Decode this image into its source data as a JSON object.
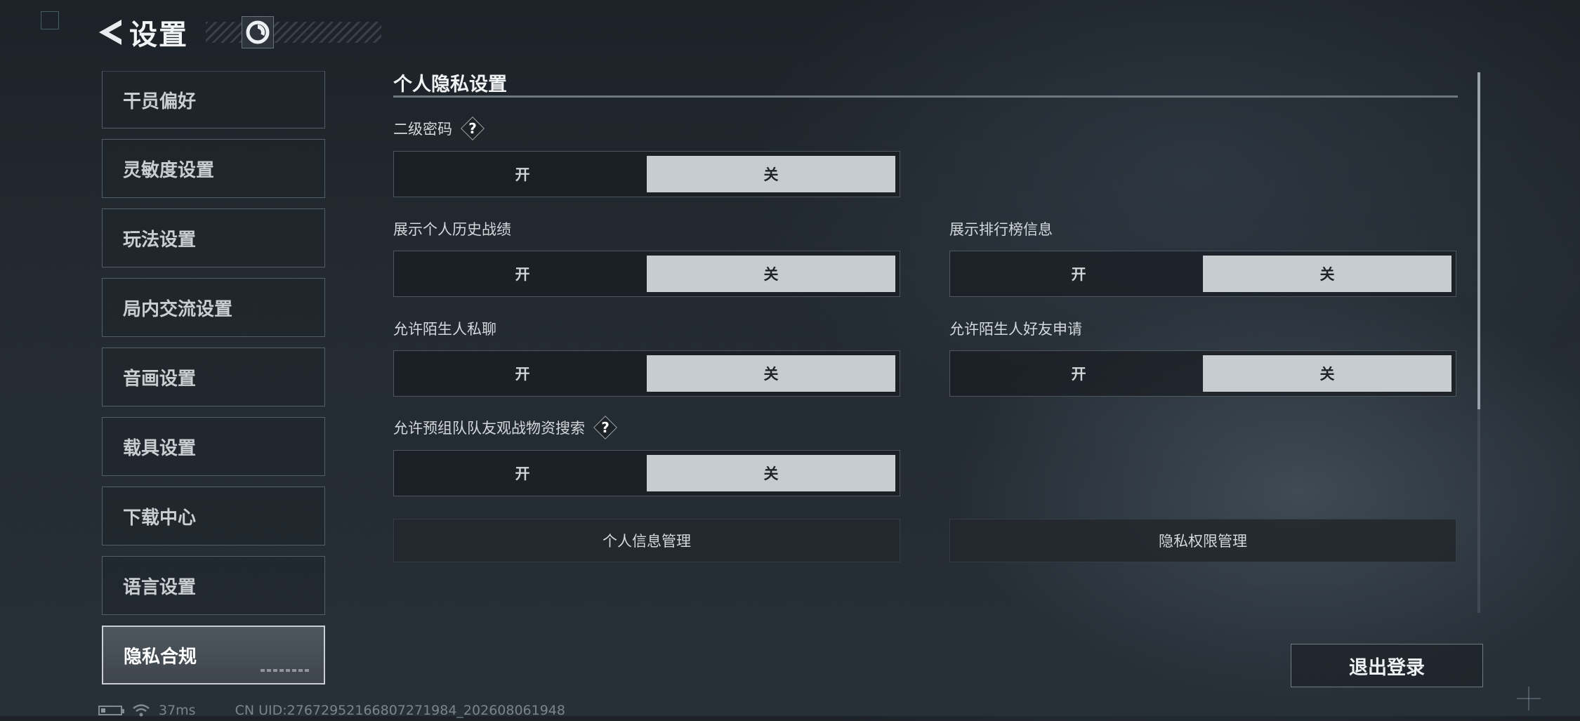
{
  "header": {
    "title": "设置",
    "back_icon": "back-arrow-icon",
    "logo_icon": "game-logo-icon"
  },
  "sidebar": {
    "items": [
      {
        "label": "干员偏好",
        "active": false
      },
      {
        "label": "灵敏度设置",
        "active": false
      },
      {
        "label": "玩法设置",
        "active": false
      },
      {
        "label": "局内交流设置",
        "active": false
      },
      {
        "label": "音画设置",
        "active": false
      },
      {
        "label": "载具设置",
        "active": false
      },
      {
        "label": "下载中心",
        "active": false
      },
      {
        "label": "语言设置",
        "active": false
      },
      {
        "label": "隐私合规",
        "active": true
      }
    ]
  },
  "main": {
    "section_title": "个人隐私设置",
    "settings": [
      {
        "label": "二级密码",
        "help": "?",
        "on_label": "开",
        "off_label": "关",
        "value": "关"
      },
      {
        "label": "展示个人历史战绩",
        "on_label": "开",
        "off_label": "关",
        "value": "关"
      },
      {
        "label": "展示排行榜信息",
        "on_label": "开",
        "off_label": "关",
        "value": "关"
      },
      {
        "label": "允许陌生人私聊",
        "on_label": "开",
        "off_label": "关",
        "value": "关"
      },
      {
        "label": "允许陌生人好友申请",
        "on_label": "开",
        "off_label": "关",
        "value": "关"
      },
      {
        "label": "允许预组队队友观战物资搜索",
        "help": "?",
        "on_label": "开",
        "off_label": "关",
        "value": "关"
      }
    ],
    "buttons": {
      "personal_info": "个人信息管理",
      "privacy_permission": "隐私权限管理"
    }
  },
  "logout_label": "退出登录",
  "status": {
    "ping": "37ms",
    "uid": "CN UID:2767295216680727198​4_202608061948"
  },
  "colors": {
    "selected_option_bg": "#c7ccd0",
    "background": "#232a31",
    "accent_text": "#f0f2f4"
  }
}
